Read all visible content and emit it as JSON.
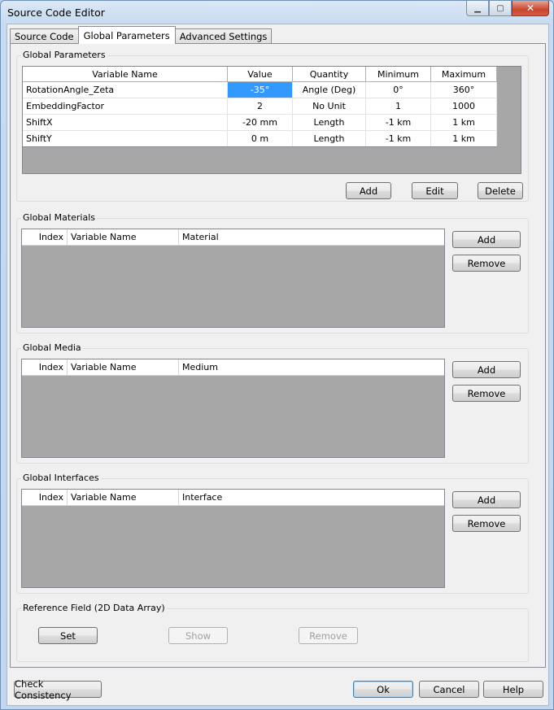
{
  "window": {
    "title": "Source Code Editor",
    "minimize_glyph": "▁",
    "maximize_glyph": "▢",
    "close_glyph": "✕"
  },
  "tabs": [
    {
      "label": "Source Code",
      "active": false
    },
    {
      "label": "Global Parameters",
      "active": true
    },
    {
      "label": "Advanced Settings",
      "active": false
    }
  ],
  "global_parameters": {
    "title": "Global Parameters",
    "columns": [
      "Variable Name",
      "Value",
      "Quantity",
      "Minimum",
      "Maximum"
    ],
    "rows": [
      [
        "RotationAngle_Zeta",
        "-35°",
        "Angle (Deg)",
        "0°",
        "360°"
      ],
      [
        "EmbeddingFactor",
        "2",
        "No Unit",
        "1",
        "1000"
      ],
      [
        "ShiftX",
        "-20 mm",
        "Length",
        "-1 km",
        "1 km"
      ],
      [
        "ShiftY",
        "0 m",
        "Length",
        "-1 km",
        "1 km"
      ]
    ],
    "add_label": "Add",
    "edit_label": "Edit",
    "delete_label": "Delete"
  },
  "global_materials": {
    "title": "Global Materials",
    "columns": [
      "Index",
      "Variable Name",
      "Material"
    ],
    "add_label": "Add",
    "remove_label": "Remove"
  },
  "global_media": {
    "title": "Global Media",
    "columns": [
      "Index",
      "Variable Name",
      "Medium"
    ],
    "add_label": "Add",
    "remove_label": "Remove"
  },
  "global_interfaces": {
    "title": "Global Interfaces",
    "columns": [
      "Index",
      "Variable Name",
      "Interface"
    ],
    "add_label": "Add",
    "remove_label": "Remove"
  },
  "reference_field": {
    "title": "Reference Field (2D Data Array)",
    "set_label": "Set",
    "show_label": "Show",
    "remove_label": "Remove"
  },
  "footer": {
    "check_label": "Check Consistency",
    "ok_label": "Ok",
    "cancel_label": "Cancel",
    "help_label": "Help"
  }
}
